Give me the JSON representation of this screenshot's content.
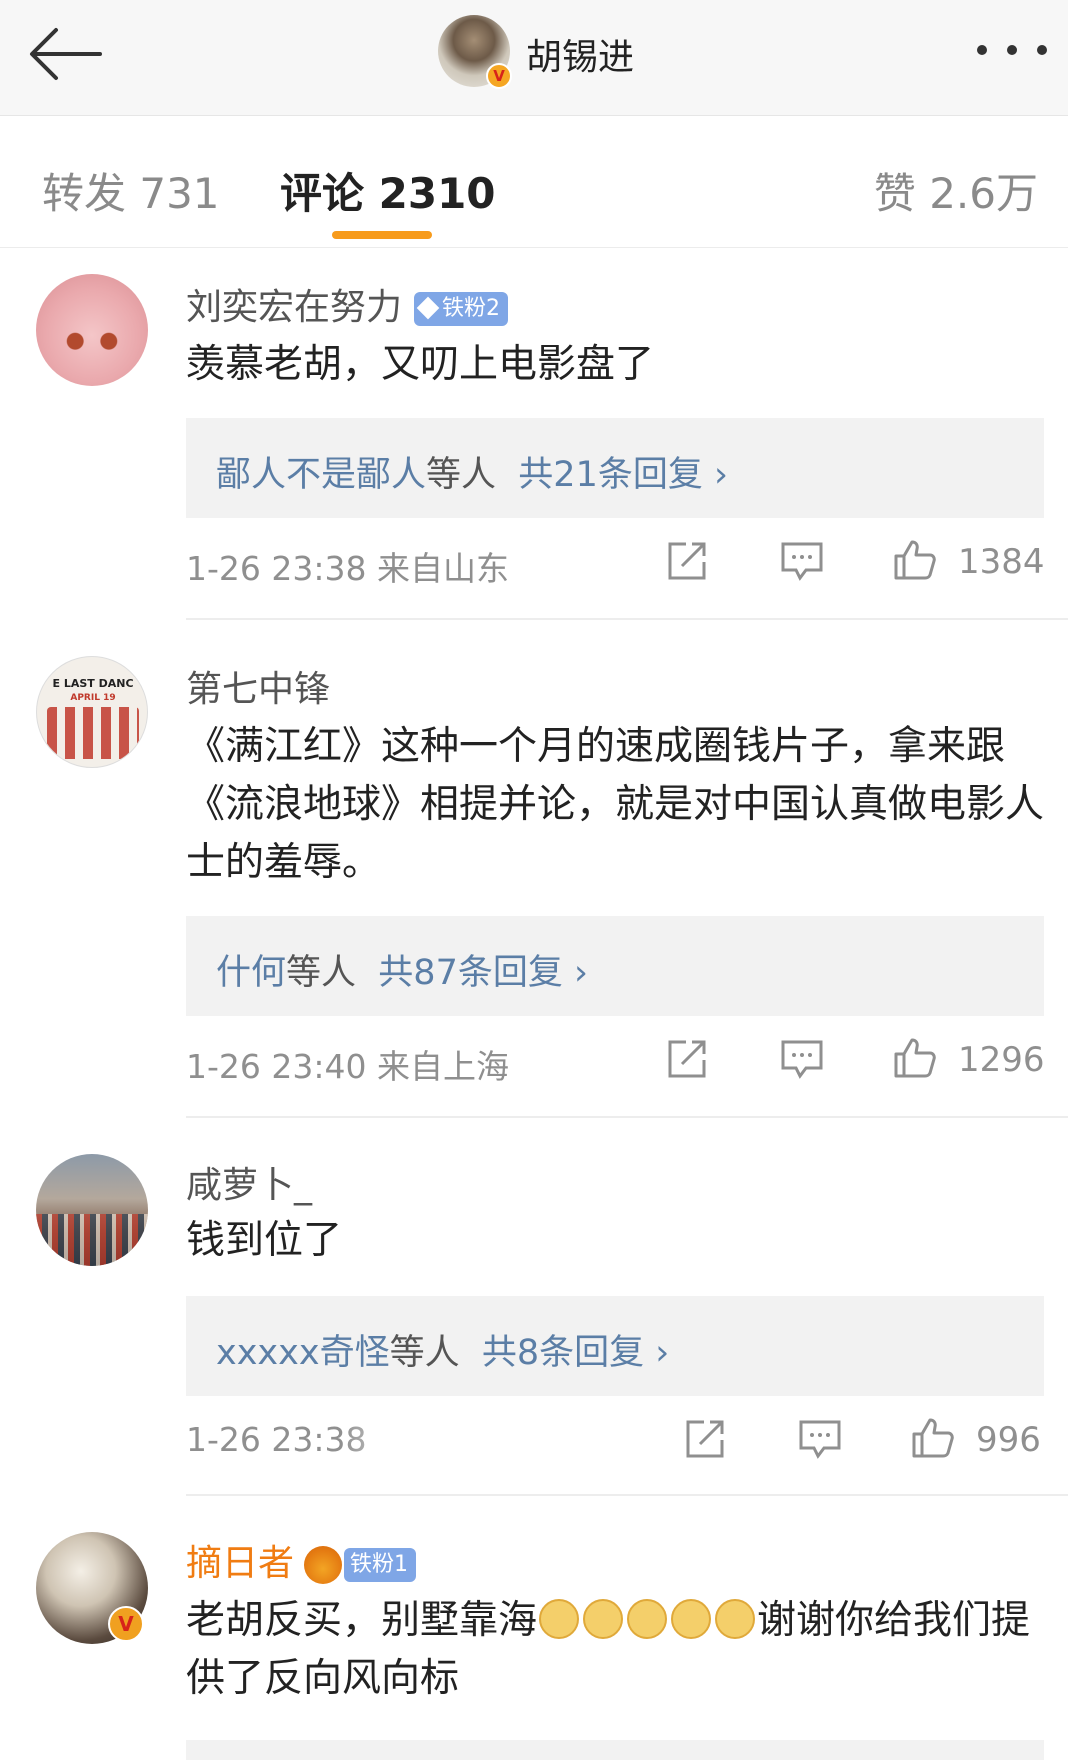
{
  "header": {
    "title": "胡锡进",
    "verified": "V"
  },
  "tabs": {
    "repost": "转发 731",
    "comment": "评论 2310",
    "like": "赞 2.6万"
  },
  "comments": [
    {
      "name": "刘奕宏在努力",
      "fan_badge": "铁粉2",
      "text": "羡慕老胡，又叨上电影盘了",
      "reply_users": "鄙人不是鄙人",
      "reply_mid": "等人",
      "reply_total": "共21条回复 ›",
      "time_location": "1-26 23:38 来自山东",
      "likes": "1384"
    },
    {
      "name": "第七中锋",
      "avatar_text": "E LAST DANC",
      "avatar_sub": "APRIL 19",
      "text": "《满江红》这种一个月的速成圈钱片子，拿来跟《流浪地球》相提并论，就是对中国认真做电影人士的羞辱。",
      "reply_users": "什何",
      "reply_mid": "等人",
      "reply_total": "共87条回复 ›",
      "time_location": "1-26 23:40 来自上海",
      "likes": "1296"
    },
    {
      "name": "咸萝卜_",
      "text": "钱到位了",
      "reply_users": "xxxxx奇怪",
      "reply_mid": "等人",
      "reply_total": "共8条回复 ›",
      "time_location": "1-26 23:38",
      "likes": "996"
    },
    {
      "name": "摘日者",
      "fan_badge": "铁粉1",
      "verified": "V",
      "text_a": "老胡反买，别墅靠海",
      "text_b": "谢谢你给我们提供了反向风向标"
    }
  ],
  "colors": {
    "accent_orange": "#f79b1c",
    "link_blue": "#5b7ea6",
    "vip_name": "#f07c12",
    "fan_badge": "#7fa6e6"
  },
  "icons": [
    "back-arrow-icon",
    "more-icon",
    "repost-icon",
    "comment-icon",
    "like-icon",
    "diamond-icon",
    "crown-icon",
    "dog-emoji-icon"
  ]
}
